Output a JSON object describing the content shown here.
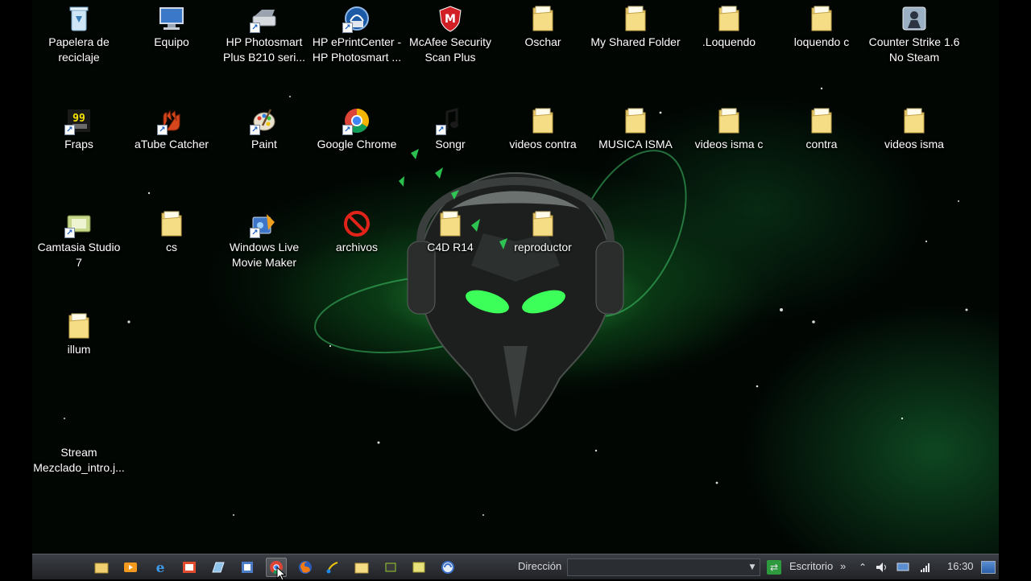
{
  "desktop": {
    "icons": [
      {
        "label": "Papelera de\nreciclaje",
        "icon": "recycle-bin-icon"
      },
      {
        "label": "Equipo",
        "icon": "computer-icon"
      },
      {
        "label": "HP Photosmart\nPlus B210 seri...",
        "icon": "scanner-icon"
      },
      {
        "label": "HP ePrintCenter -\nHP Photosmart ...",
        "icon": "eprint-icon"
      },
      {
        "label": "McAfee Security\nScan Plus",
        "icon": "mcafee-shield-icon"
      },
      {
        "label": "Oschar",
        "icon": "folder-icon"
      },
      {
        "label": "My Shared Folder",
        "icon": "folder-icon"
      },
      {
        "label": ".Loquendo",
        "icon": "folder-icon"
      },
      {
        "label": "loquendo c",
        "icon": "folder-icon"
      },
      {
        "label": "Counter Strike 1.6\nNo Steam",
        "icon": "counter-strike-icon"
      },
      {
        "label": "Fraps",
        "icon": "fraps-icon"
      },
      {
        "label": "aTube Catcher",
        "icon": "atube-catcher-icon"
      },
      {
        "label": "Paint",
        "icon": "paint-palette-icon"
      },
      {
        "label": "Google Chrome",
        "icon": "chrome-icon"
      },
      {
        "label": "Songr",
        "icon": "music-note-icon"
      },
      {
        "label": "videos contra",
        "icon": "folder-icon"
      },
      {
        "label": "MUSICA ISMA",
        "icon": "folder-icon"
      },
      {
        "label": "videos isma c",
        "icon": "folder-icon"
      },
      {
        "label": "contra",
        "icon": "folder-icon"
      },
      {
        "label": "videos isma",
        "icon": "folder-icon"
      },
      {
        "label": "Camtasia Studio\n7",
        "icon": "camtasia-icon"
      },
      {
        "label": "cs",
        "icon": "folder-icon"
      },
      {
        "label": "Windows Live\nMovie Maker",
        "icon": "movie-maker-icon"
      },
      {
        "label": "archivos",
        "icon": "prohibited-icon"
      },
      {
        "label": "C4D R14",
        "icon": "folder-icon"
      },
      {
        "label": "reproductor",
        "icon": "folder-icon"
      },
      {
        "label": "illum",
        "icon": "folder-icon"
      },
      {
        "label": "Stream\nMezclado_intro.j...",
        "icon": "video-file-icon"
      }
    ]
  },
  "taskbar": {
    "quicklaunch": [
      {
        "icon": "explorer-folder-icon"
      },
      {
        "icon": "media-player-icon"
      },
      {
        "icon": "internet-explorer-icon"
      },
      {
        "icon": "photo-app-icon"
      },
      {
        "icon": "notepad-icon"
      },
      {
        "icon": "document-icon"
      },
      {
        "icon": "chrome-icon"
      },
      {
        "icon": "firefox-icon"
      },
      {
        "icon": "paint-tool-icon"
      },
      {
        "icon": "folder-icon"
      },
      {
        "icon": "tool-icon"
      },
      {
        "icon": "notes-icon"
      },
      {
        "icon": "sync-icon"
      }
    ],
    "address_label": "Dirección",
    "address_value": "",
    "desktop_label": "Escritorio",
    "chevron": "»",
    "clock": "16:30"
  },
  "colors": {
    "taskbar": "#2c2f34",
    "glow": "#35e060",
    "folder": "#f2d675"
  }
}
